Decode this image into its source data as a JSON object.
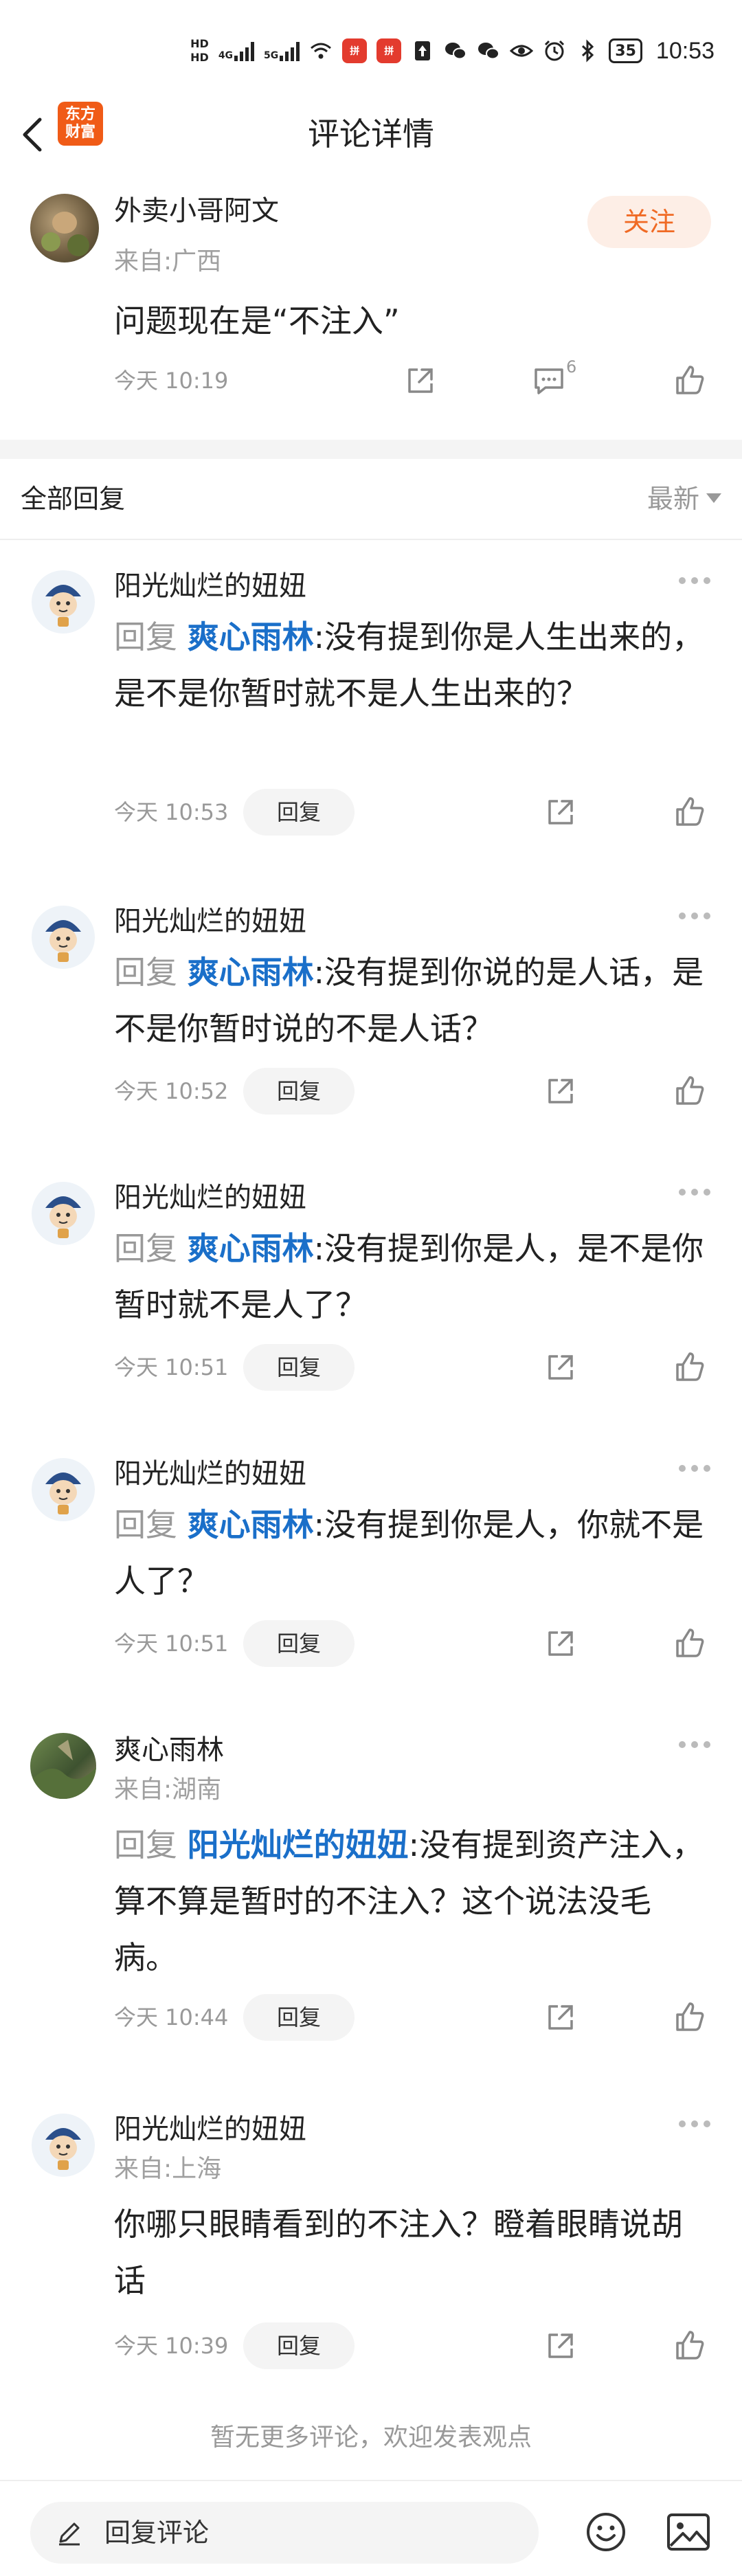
{
  "status_bar": {
    "hd1": "HD",
    "hd2": "HD",
    "net1": "4G",
    "net2": "5G",
    "battery": "35",
    "time": "10:53"
  },
  "nav": {
    "logo_line1": "东方",
    "logo_line2": "财富",
    "title": "评论详情"
  },
  "top_comment": {
    "nickname": "外卖小哥阿文",
    "location": "来自:广西",
    "follow_label": "关注",
    "text": "问题现在是“不注入”",
    "time": "今天 10:19",
    "reply_count": "6"
  },
  "section": {
    "title": "全部回复",
    "sort": "最新"
  },
  "reply_label": "回复",
  "replies": [
    {
      "nickname": "阳光灿烂的妞妞",
      "prefix": "回复",
      "mention": "爽心雨林",
      "text": ":没有提到你是人生出来的，是不是你暂时就不是人生出来的？",
      "time": "今天 10:53",
      "reply_button": "回复"
    },
    {
      "nickname": "阳光灿烂的妞妞",
      "prefix": "回复",
      "mention": "爽心雨林",
      "text": ":没有提到你说的是人话，是不是你暂时说的不是人话？",
      "time": "今天 10:52",
      "reply_button": "回复"
    },
    {
      "nickname": "阳光灿烂的妞妞",
      "prefix": "回复",
      "mention": "爽心雨林",
      "text": ":没有提到你是人，是不是你暂时就不是人了？",
      "time": "今天 10:51",
      "reply_button": "回复"
    },
    {
      "nickname": "阳光灿烂的妞妞",
      "prefix": "回复",
      "mention": "爽心雨林",
      "text": ":没有提到你是人，你就不是人了？",
      "time": "今天 10:51",
      "reply_button": "回复"
    },
    {
      "nickname": "爽心雨林",
      "location": "来自:湖南",
      "prefix": "回复",
      "mention": "阳光灿烂的妞妞",
      "text": ":没有提到资产注入，算不算是暂时的不注入？这个说法没毛病。",
      "time": "今天 10:44",
      "reply_button": "回复"
    },
    {
      "nickname": "阳光灿烂的妞妞",
      "location": "来自:上海",
      "text": "你哪只眼睛看到的不注入？瞪着眼睛说胡话",
      "time": "今天 10:39",
      "reply_button": "回复"
    }
  ],
  "end_note": "暂无更多评论，欢迎发表观点",
  "bottom_bar": {
    "placeholder": "回复评论"
  },
  "colors": {
    "accent": "#f06a24",
    "mention": "#1a6fc9",
    "muted": "#999999"
  }
}
